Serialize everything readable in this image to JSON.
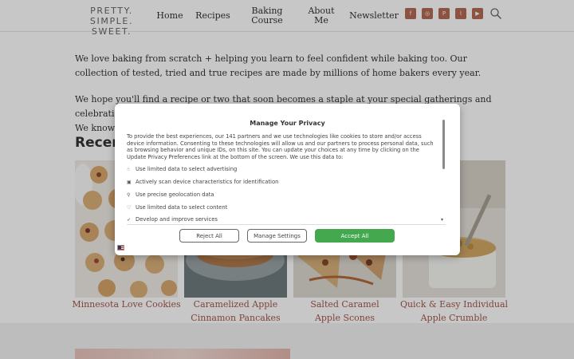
{
  "site": {
    "logo_line1": "PRETTY. SIMPLE.",
    "logo_line2": "SWEET."
  },
  "nav": {
    "home": "Home",
    "recipes": "Recipes",
    "baking_line1": "Baking",
    "baking_line2": "Course",
    "about_line1": "About",
    "about_line2": "Me",
    "newsletter": "Newsletter"
  },
  "social": [
    {
      "icon": "facebook-icon",
      "glyph": "f"
    },
    {
      "icon": "instagram-icon",
      "glyph": "◎"
    },
    {
      "icon": "pinterest-icon",
      "glyph": "P"
    },
    {
      "icon": "rss-icon",
      "glyph": "⌇"
    },
    {
      "icon": "youtube-icon",
      "glyph": "▶"
    }
  ],
  "brand_color": "#b46a55",
  "accent_color": "#44a84f",
  "intro": {
    "p1": "We love baking from scratch + helping you learn to feel confident while baking too. Our collection of tested, tried and true recipes are made by millions of home bakers every year.",
    "p2_line1": "We hope you'll find a recipe or two that soon becomes a staple at your special gatherings and celebrations.",
    "p2_line2": "We know I"
  },
  "recent": {
    "title": "Recent",
    "cards": [
      {
        "title_line1": "Minnesota Love Cookies",
        "title_line2": ""
      },
      {
        "title_line1": "Caramelized Apple",
        "title_line2": "Cinnamon Pancakes"
      },
      {
        "title_line1": "Salted Caramel",
        "title_line2": "Apple Scones"
      },
      {
        "title_line1": "Quick & Easy Individual",
        "title_line2": "Apple Crumble"
      }
    ]
  },
  "privacy_modal": {
    "title": "Manage Your Privacy",
    "description": "To provide the best experiences, our 141 partners and we use technologies like cookies to store and/or access device information. Consenting to these technologies will allow us and our partners to process personal data, such as browsing behavior and unique IDs, on this site. You can update your choices at any time by clicking on the Update Privacy Preferences link at the bottom of the screen. We use this data to:",
    "purposes": [
      {
        "icon": "hand-icon",
        "glyph": "☝",
        "label": "Use limited data to select advertising"
      },
      {
        "icon": "device-icon",
        "glyph": "▣",
        "label": "Actively scan device characteristics for identification"
      },
      {
        "icon": "location-pin-icon",
        "glyph": "⚲",
        "label": "Use precise geolocation data"
      },
      {
        "icon": "heart-icon",
        "glyph": "♡",
        "label": "Use limited data to select content"
      },
      {
        "icon": "rocket-icon",
        "glyph": "➶",
        "label": "Develop and improve services"
      }
    ],
    "reject_label": "Reject All",
    "settings_label": "Manage Settings",
    "accept_label": "Accept All"
  }
}
